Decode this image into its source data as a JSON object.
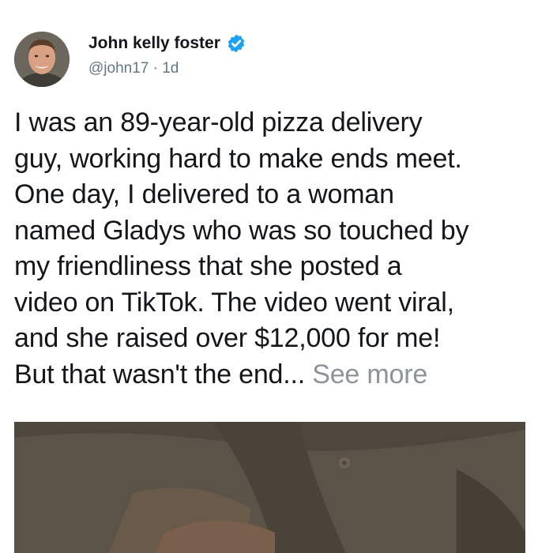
{
  "post": {
    "author_name": "John kelly foster",
    "handle": "@john17",
    "separator": "·",
    "timestamp": "1d",
    "body_lines": [
      "I was an 89-year-old pizza delivery",
      "guy, working hard to make ends meet.",
      "One day, I delivered to a woman",
      "named Gladys who was so touched by",
      "my friendliness that she posted a",
      "video on TikTok. The video went viral,",
      "and she raised over $12,000 for me!"
    ],
    "last_line": "But that wasn't the end...",
    "see_more_label": "See more"
  },
  "icons": {
    "verified": "verified-badge-icon",
    "avatar": "profile-photo"
  },
  "colors": {
    "verified_blue": "#1da1f2",
    "handle_gray": "#657786",
    "see_more_gray": "#8b9499",
    "text": "#14171a"
  }
}
